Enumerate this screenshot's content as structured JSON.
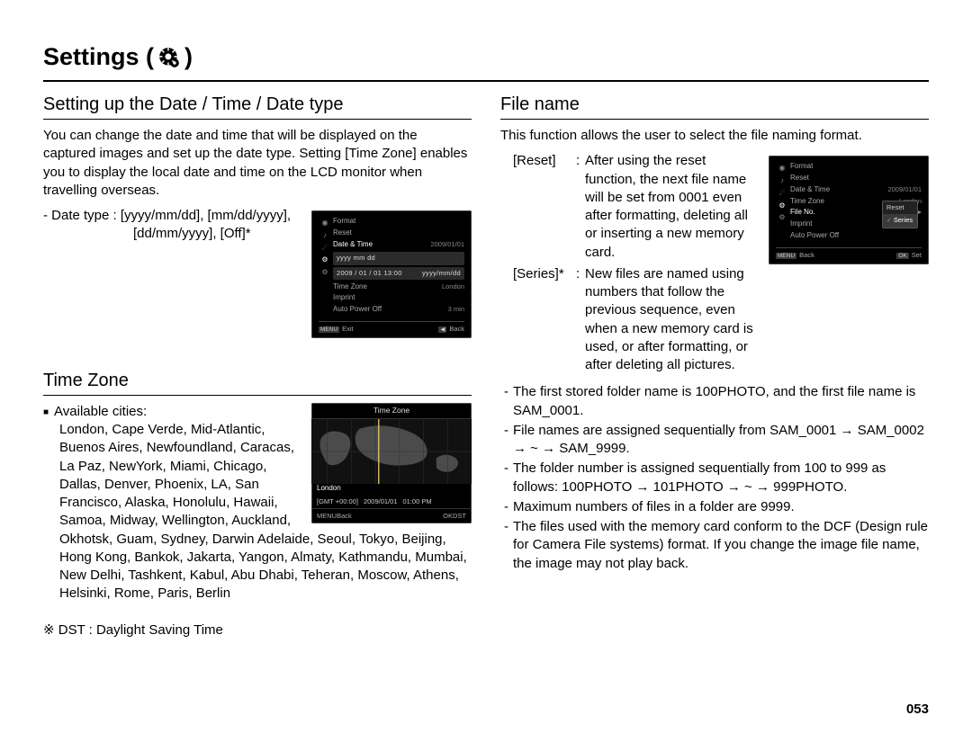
{
  "page_number": "053",
  "page_title_prefix": "Settings (",
  "page_title_suffix": ")",
  "left": {
    "section1_heading": "Setting up the Date / Time / Date type",
    "section1_body": "You can change the date and time that will be displayed on the captured images and set up the date type. Setting [Time Zone] enables you to display the local date and time on the LCD monitor when travelling overseas.",
    "date_type_line1": "- Date type : [yyyy/mm/dd], [mm/dd/yyyy],",
    "date_type_line2": "[dd/mm/yyyy], [Off]*",
    "section2_heading": "Time Zone",
    "avail_label": "Available cities:",
    "cities": "London, Cape Verde, Mid-Atlantic, Buenos Aires, Newfoundland, Caracas, La Paz, NewYork, Miami, Chicago, Dallas, Denver, Phoenix, LA, San Francisco, Alaska, Honolulu, Hawaii, Samoa, Midway, Wellington, Auckland, Okhotsk, Guam, Sydney, Darwin Adelaide, Seoul, Tokyo, Beijing, Hong Kong, Bankok, Jakarta, Yangon, Almaty, Kathmandu, Mumbai, New Delhi, Tashkent, Kabul, Abu Dhabi, Teheran, Moscow, Athens, Helsinki, Rome, Paris, Berlin",
    "dst_note": "※ DST : Daylight Saving Time"
  },
  "right": {
    "section_heading": "File name",
    "intro": "This function allows the user to select the file naming format.",
    "reset_key": "[Reset]",
    "reset_val": "After using the reset function, the next file name will be set from 0001 even after formatting, deleting all or inserting a new memory card.",
    "series_key": "[Series]*",
    "series_val": "New files are named using numbers that follow the previous sequence, even when a new memory card is used, or after formatting, or after deleting all pictures.",
    "bullets": [
      "The first stored folder name is 100PHOTO, and the first file name is SAM_0001.",
      "File names are assigned sequentially from SAM_0001 → SAM_0002 → ~ → SAM_9999.",
      "The folder number is assigned sequentially from 100 to 999 as follows: 100PHOTO → 101PHOTO → ~ → 999PHOTO.",
      "Maximum numbers of files in a folder are 9999.",
      "The files used with the memory card conform to the DCF (Design rule for Camera File systems) format. If you change the image file name, the image may not play back."
    ]
  },
  "lcd_date": {
    "items": [
      "Format",
      "Reset",
      "Date & Time",
      "Time Zone",
      "Imprint",
      "Auto Power Off"
    ],
    "active_index": 2,
    "value_line1": "yyyy mm dd",
    "value_line2_left": "2009 / 01 / 01    13:00",
    "value_line2_right": "yyyy/mm/dd",
    "right_val": "2009/01/01",
    "tz_right": "London",
    "apo_right": "3 min",
    "foot_left": "Exit",
    "foot_right": "Back",
    "menu_btn": "MENU"
  },
  "lcd_tz": {
    "title": "Time Zone",
    "city": "London",
    "gmt": "[GMT +00:00]",
    "date": "2009/01/01",
    "time": "01:00 PM",
    "foot_left": "Back",
    "foot_right": "DST",
    "menu_btn": "MENU",
    "ok_btn": "OK"
  },
  "lcd_file": {
    "items": [
      "Format",
      "Reset",
      "Date & Time",
      "Time Zone",
      "File No.",
      "Imprint",
      "Auto Power Off"
    ],
    "active_index": 4,
    "date_val": "2009/01/01",
    "tz_val": "London",
    "popup": [
      "Reset",
      "Series"
    ],
    "popup_sel_index": 1,
    "foot_left": "Back",
    "foot_right": "Set",
    "menu_btn": "MENU",
    "ok_btn": "OK"
  }
}
